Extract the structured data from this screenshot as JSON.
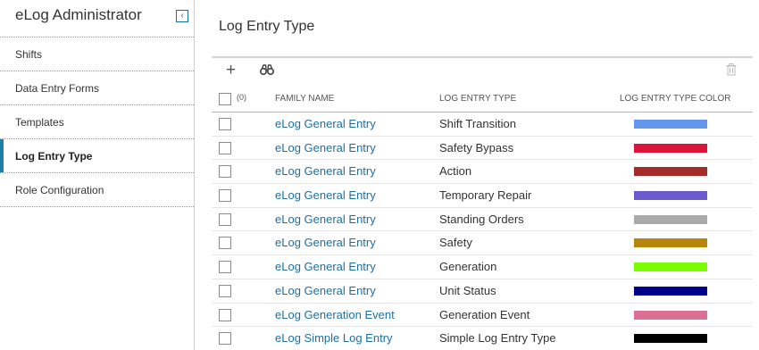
{
  "sidebar": {
    "title": "eLog Administrator",
    "collapse_icon": "chevron-left-icon",
    "items": [
      {
        "label": "Shifts"
      },
      {
        "label": "Data Entry Forms"
      },
      {
        "label": "Templates"
      },
      {
        "label": "Log Entry Type",
        "active": true
      },
      {
        "label": "Role Configuration"
      }
    ]
  },
  "main": {
    "title": "Log Entry Type",
    "toolbar": {
      "add_icon": "plus-icon",
      "find_icon": "binoculars-icon",
      "delete_icon": "trash-icon"
    },
    "grid": {
      "selected_count": "(0)",
      "columns": [
        "FAMILY NAME",
        "LOG ENTRY TYPE",
        "LOG ENTRY TYPE COLOR"
      ],
      "rows": [
        {
          "family": "eLog General Entry",
          "type": "Shift Transition",
          "color": "#6495ED"
        },
        {
          "family": "eLog General Entry",
          "type": "Safety Bypass",
          "color": "#DC143C"
        },
        {
          "family": "eLog General Entry",
          "type": "Action",
          "color": "#A52A2A"
        },
        {
          "family": "eLog General Entry",
          "type": "Temporary Repair",
          "color": "#6A5ACD"
        },
        {
          "family": "eLog General Entry",
          "type": "Standing Orders",
          "color": "#A9A9A9"
        },
        {
          "family": "eLog General Entry",
          "type": "Safety",
          "color": "#B8860B"
        },
        {
          "family": "eLog General Entry",
          "type": "Generation",
          "color": "#7CFC00"
        },
        {
          "family": "eLog General Entry",
          "type": "Unit Status",
          "color": "#00008B"
        },
        {
          "family": "eLog Generation Event",
          "type": "Generation Event",
          "color": "#DB7093"
        },
        {
          "family": "eLog Simple Log Entry",
          "type": "Simple Log Entry Type",
          "color": "#000000"
        }
      ]
    }
  }
}
